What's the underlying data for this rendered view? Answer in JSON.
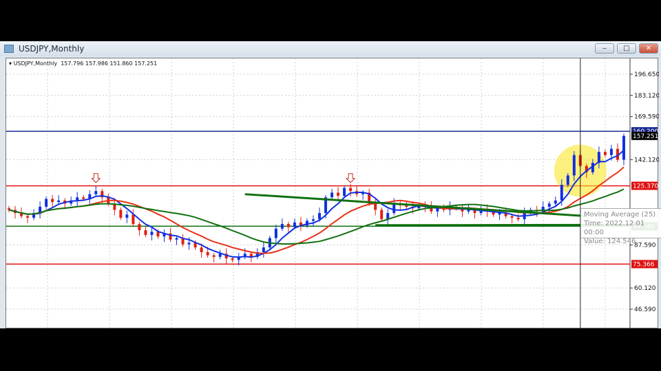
{
  "window": {
    "title": "USDJPY,Monthly",
    "minimize": "‒",
    "maximize": "□",
    "close": "✕"
  },
  "legend": {
    "symbol": "USDJPY,Monthly",
    "open": "157.796",
    "high": "157.986",
    "low": "151.860",
    "close": "157.251"
  },
  "tooltip": {
    "name": "Moving Average (25)",
    "time": "Time: 2022.12.01 00:00",
    "value": "Value: 124.546"
  },
  "colors": {
    "bull": "#1030e0",
    "bear": "#e02010",
    "ma_fast": "#1030e0",
    "ma_mid": "#e83018",
    "ma_slow": "#107010"
  },
  "chart_data": {
    "type": "candlestick",
    "symbol": "USDJPY",
    "timeframe": "Monthly",
    "ylim": [
      33.06,
      205
    ],
    "y_ticks": [
      "196.650",
      "183.120",
      "169.590",
      "142.120",
      "87.590",
      "60.120",
      "46.590"
    ],
    "closes": [
      110,
      108,
      106,
      105,
      108,
      112,
      117,
      115,
      116,
      114,
      116,
      118,
      117,
      120,
      122,
      118,
      114,
      110,
      105,
      107,
      101,
      97,
      94,
      96,
      93,
      95,
      91,
      92,
      88,
      89,
      86,
      83,
      81,
      80,
      82,
      79,
      78,
      80,
      82,
      80,
      83,
      86,
      92,
      98,
      101,
      99,
      102,
      100,
      103,
      104,
      108,
      118,
      121,
      119,
      124,
      122,
      120,
      121,
      114,
      110,
      104,
      108,
      114,
      113,
      112,
      111,
      113,
      112,
      109,
      111,
      110,
      112,
      111,
      109,
      110,
      108,
      110,
      109,
      107,
      108,
      106,
      105,
      104,
      108,
      110,
      109,
      112,
      114,
      116,
      126,
      132,
      145,
      138,
      134,
      140,
      147,
      145,
      149,
      142,
      157.251
    ],
    "moving_averages": [
      {
        "period": 5,
        "color": "ma_fast"
      },
      {
        "period": 13,
        "color": "ma_mid"
      },
      {
        "period": 25,
        "color": "ma_slow"
      }
    ],
    "hlines": [
      {
        "value": 160.2,
        "label": "160.200",
        "color": "#1a2a90"
      },
      {
        "value": 157.251,
        "label": "157.251",
        "color": "#000000"
      },
      {
        "value": 125.37,
        "label": "125.370",
        "color": "#e01010"
      },
      {
        "value": 99.546,
        "label": "99.546",
        "color": "#107010"
      },
      {
        "value": 75.366,
        "label": "75.366",
        "color": "#e01010"
      }
    ],
    "trendline": {
      "from_index": 38,
      "from_value": 120,
      "to_index": 92,
      "to_value": 107
    },
    "arrows_at_index": [
      14,
      55
    ],
    "highlight_index": 92
  }
}
